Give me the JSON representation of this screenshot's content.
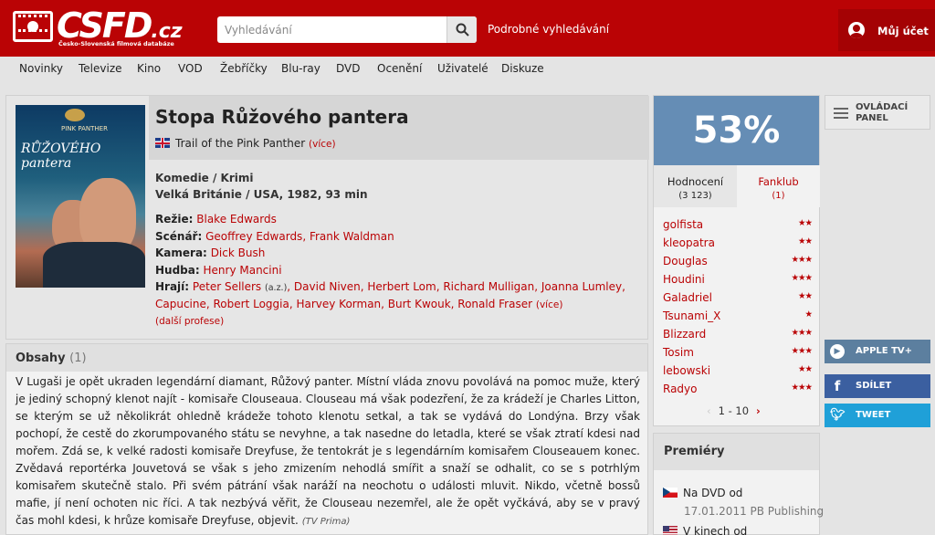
{
  "header": {
    "logo_text": "CSFD",
    "logo_suffix": ".cz",
    "logo_tagline": "Česko-Slovenská filmová databáze",
    "search_placeholder": "Vyhledávání",
    "advanced_search": "Podrobné vyhledávání",
    "account": "Můj účet"
  },
  "nav": [
    "Novinky",
    "Televize",
    "Kino",
    "VOD",
    "Žebříčky",
    "Blu-ray",
    "DVD",
    "Ocenění",
    "Uživatelé",
    "Diskuze"
  ],
  "film": {
    "poster_top_text": "PINK PANTHER",
    "poster_title": "RŮŽOVÉHO pantera",
    "title": "Stopa Růžového pantera",
    "original_title": "Trail of the Pink Panther",
    "original_more": "(více)",
    "genre": "Komedie / Krimi",
    "origin": "Velká Británie / USA, 1982, 93 min",
    "director_label": "Režie:",
    "director": "Blake Edwards",
    "writer_label": "Scénář:",
    "writers": "Geoffrey Edwards, Frank Waldman",
    "camera_label": "Kamera:",
    "camera": "Dick Bush",
    "music_label": "Hudba:",
    "music": "Henry Mancini",
    "cast_label": "Hrají:",
    "cast_first": "Peter Sellers",
    "cast_az": "(a.z.)",
    "cast_line1": ", David Niven, Herbert Lom, Richard Mulligan, Joanna Lumley,",
    "cast_line2": "Capucine, Robert Loggia, Harvey Korman, Burt Kwouk, Ronald Fraser",
    "cast_more": "(více)",
    "more_professions": "(další profese)"
  },
  "plot": {
    "heading": "Obsahy",
    "count": "(1)",
    "text": "V Lugaši je opět ukraden legendární diamant, Růžový panter. Místní vláda znovu povolává na pomoc muže, který je jediný schopný klenot najít - komisaře Clouseaua. Clouseau má však podezření, že za krádeží je Charles Litton, se kterým se už několikrát ohledně krádeže tohoto klenotu setkal, a tak se vydává do Londýna. Brzy však pochopí, že cestě do zkorumpovaného státu se nevyhne, a tak nasedne do letadla, které se však ztratí kdesi nad mořem. Zdá se, k velké radosti komisaře Dreyfuse, že tentokrát je s legendárním komisařem Clouseauem konec. Zvědavá reportérka Jouvetová se však s jeho zmizením nehodlá smířit a snaží se odhalit, co se s potrhlým komisařem skutečně stalo. Při svém pátrání však naráží na neochotu o události mluvit. Nikdo, včetně bossů mafie, jí není ochoten nic říci. A tak nezbývá věřit, že Clouseau nezemřel, ale že opět vyčkává, aby se v pravý čas mohl kdesi, k hrůze komisaře Dreyfuse, objevit.",
    "source": "(TV Prima)"
  },
  "rating": {
    "percent": "53%",
    "tab_rating": "Hodnocení",
    "tab_rating_count": "(3 123)",
    "tab_fanclub": "Fanklub",
    "tab_fanclub_count": "(1)",
    "raters": [
      {
        "name": "golfista",
        "stars": "★★"
      },
      {
        "name": "kleopatra",
        "stars": "★★"
      },
      {
        "name": "Douglas",
        "stars": "★★★"
      },
      {
        "name": "Houdini",
        "stars": "★★★"
      },
      {
        "name": "Galadriel",
        "stars": "★★"
      },
      {
        "name": "Tsunami_X",
        "stars": "★"
      },
      {
        "name": "Blizzard",
        "stars": "★★★"
      },
      {
        "name": "Tosim",
        "stars": "★★★"
      },
      {
        "name": "lebowski",
        "stars": "★★"
      },
      {
        "name": "Radyo",
        "stars": "★★★"
      }
    ],
    "pager_prev": "‹",
    "pager": "1 - 10",
    "pager_next": "›"
  },
  "premieres": {
    "heading": "Premiéry",
    "item1_label": "Na DVD od",
    "item1_date": "17.01.2011 PB Publishing",
    "item2_label": "V kinech od"
  },
  "side": {
    "control_panel": "OVLÁDACÍ PANEL",
    "apple_tv": "APPLE TV+",
    "share": "SDÍLET",
    "tweet": "TWEET"
  },
  "colors": {
    "brand": "#ba0305",
    "rating": "#658db5"
  }
}
